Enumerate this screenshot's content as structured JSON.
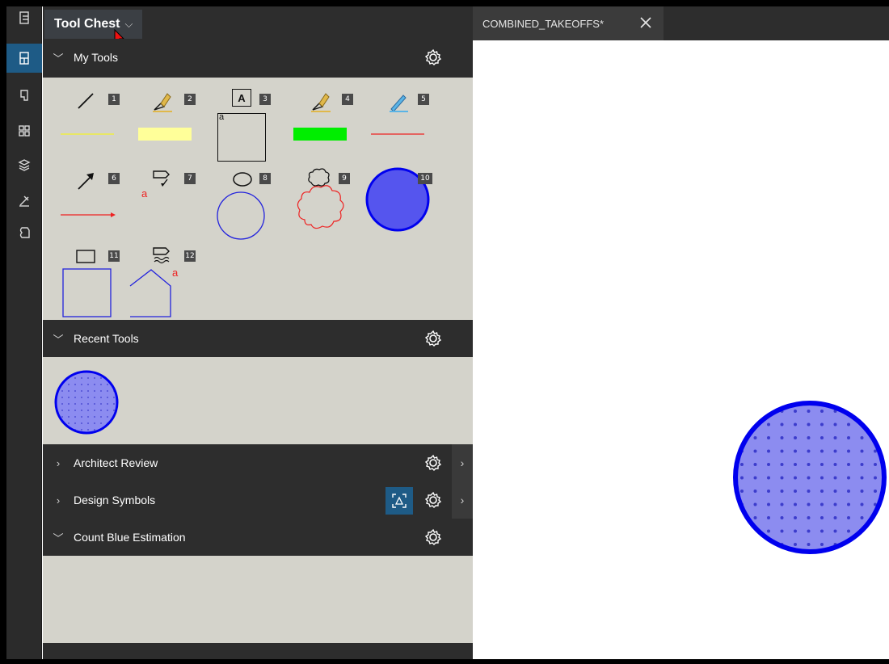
{
  "tool_chest": {
    "title": "Tool Chest",
    "chevron": "⌵"
  },
  "sections": {
    "my_tools": {
      "label": "My Tools",
      "expanded": true
    },
    "recent_tools": {
      "label": "Recent Tools",
      "expanded": true
    },
    "architect_review": {
      "label": "Architect Review",
      "expanded": false
    },
    "design_symbols": {
      "label": "Design Symbols",
      "expanded": false
    },
    "count_blue_estimation": {
      "label": "Count Blue Estimation",
      "expanded": true
    }
  },
  "tools": [
    {
      "n": "1",
      "icon": "line-icon"
    },
    {
      "n": "2",
      "icon": "highlighter-icon"
    },
    {
      "n": "3",
      "icon": "text-box-icon",
      "letter": "A",
      "preview_text": "a"
    },
    {
      "n": "4",
      "icon": "highlighter-icon"
    },
    {
      "n": "5",
      "icon": "pen-icon"
    },
    {
      "n": "6",
      "icon": "arrow-icon"
    },
    {
      "n": "7",
      "icon": "callout-icon",
      "preview_text": "a"
    },
    {
      "n": "8",
      "icon": "ellipse-icon"
    },
    {
      "n": "9",
      "icon": "cloud-icon"
    },
    {
      "n": "10",
      "icon": "filled-circle-icon"
    },
    {
      "n": "11",
      "icon": "rectangle-icon"
    },
    {
      "n": "12",
      "icon": "polygon-callout-icon",
      "preview_text": "a"
    }
  ],
  "colors": {
    "accent": "#1e5b86",
    "panel_bg": "#2d2d2d",
    "tool_area_bg": "#d4d3cb",
    "highlight_yellow": "#ffff99",
    "highlight_green": "#00ff00",
    "blue_circle_fill": "#5555ee",
    "blue_stroke": "#0000ee",
    "red": "#ee2222"
  },
  "document": {
    "tab_label": "COMBINED_TAKEOFFS*"
  }
}
